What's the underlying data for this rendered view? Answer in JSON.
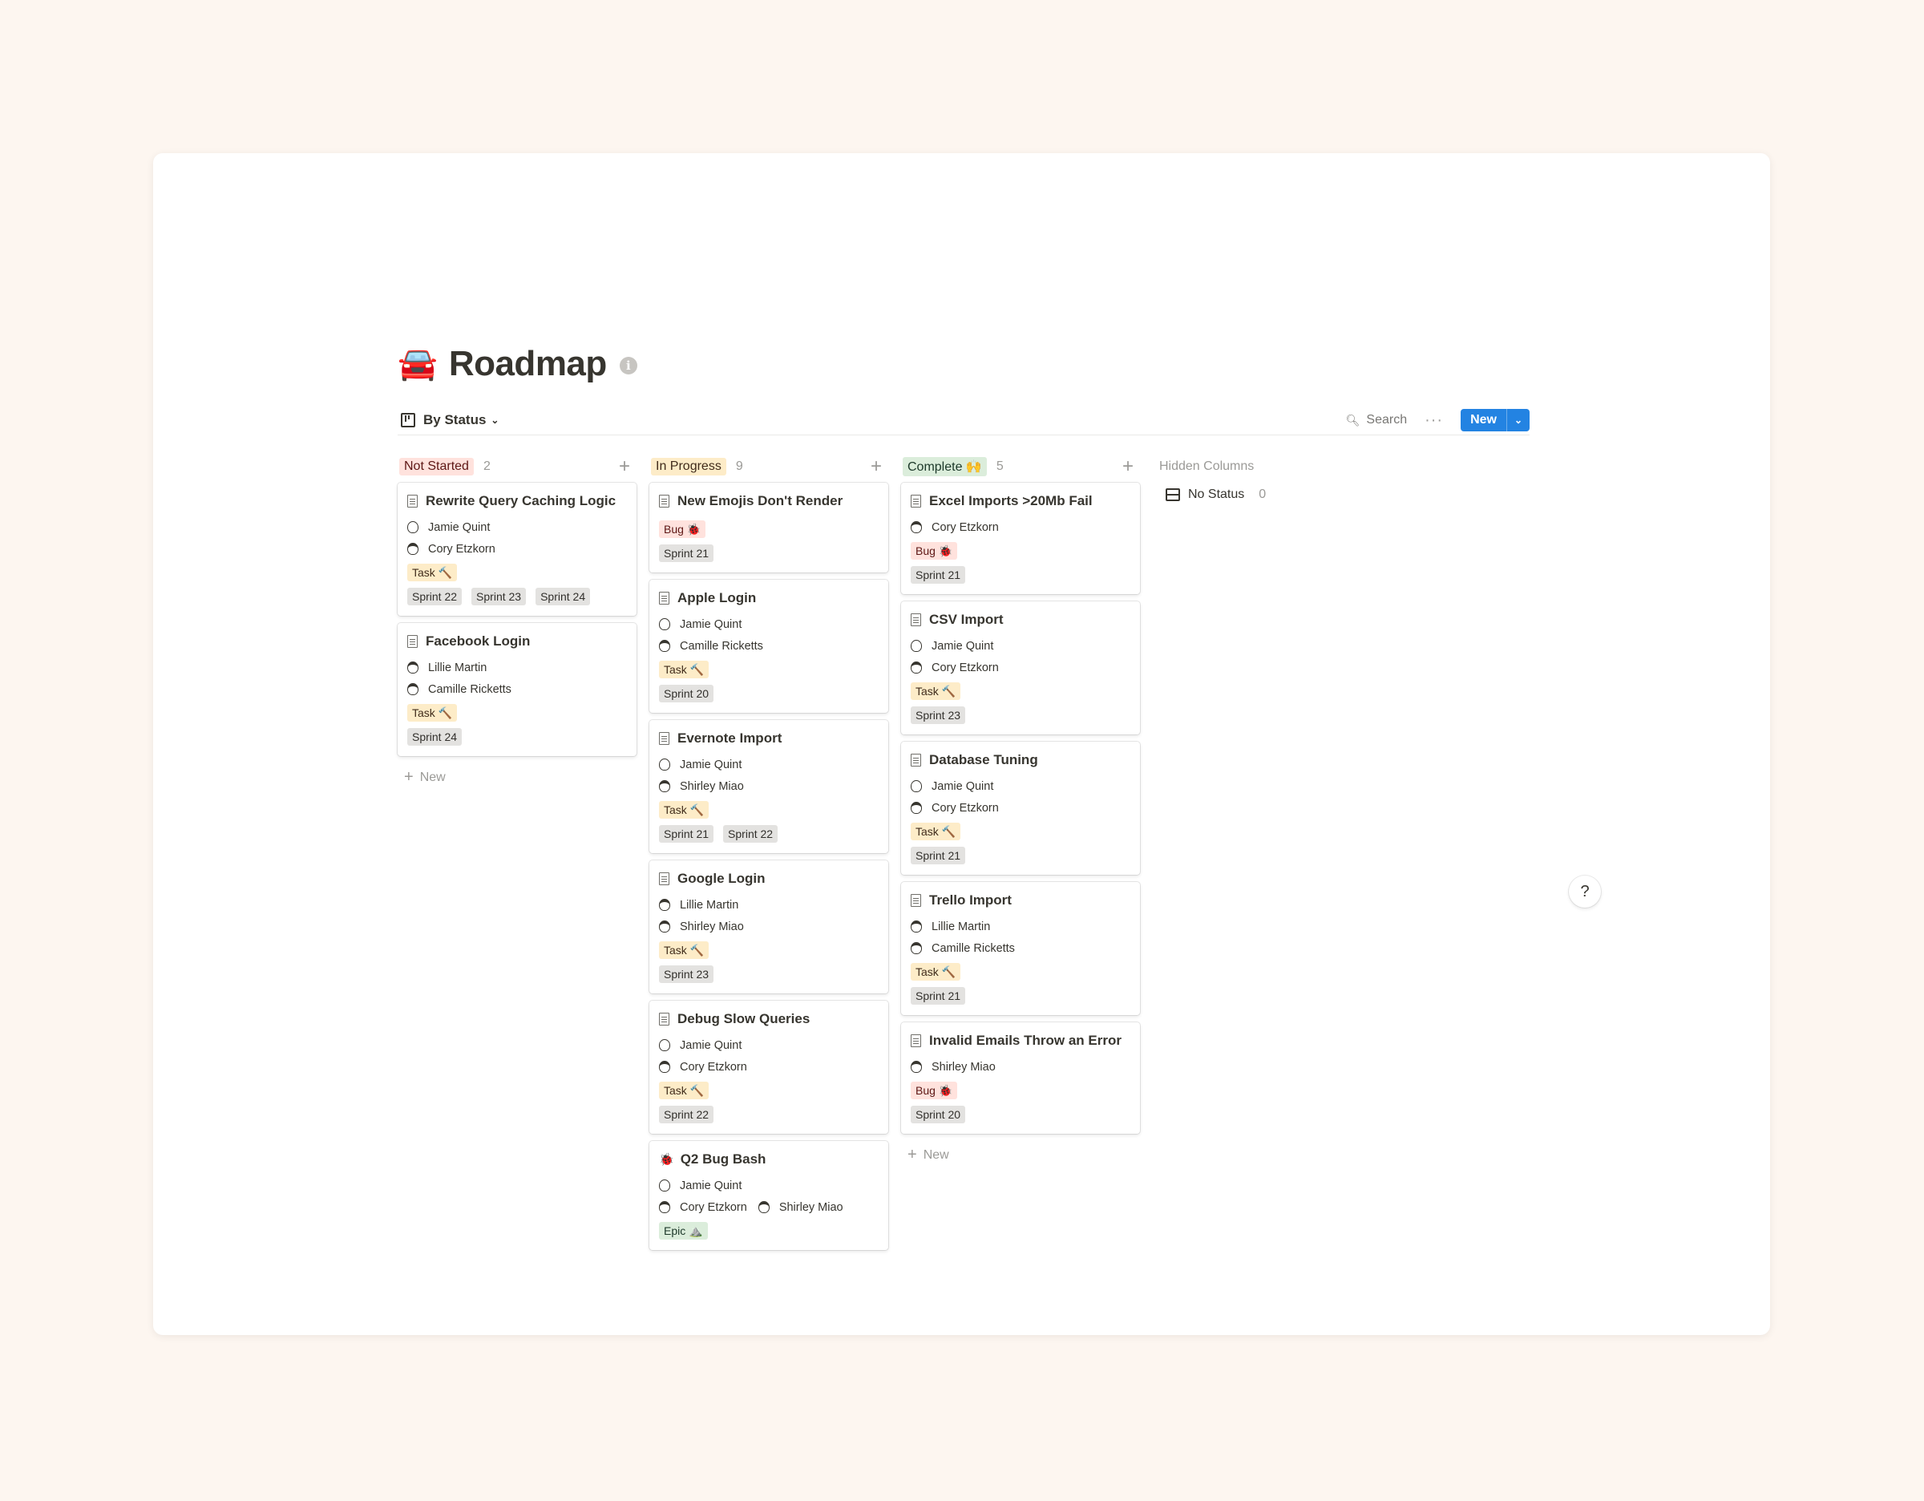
{
  "page": {
    "emoji": "🚘",
    "title": "Roadmap",
    "info_icon": "i"
  },
  "toolbar": {
    "view_label": "By Status",
    "search_label": "Search",
    "more_label": "···",
    "new_label": "New"
  },
  "columns": [
    {
      "status": "Not Started",
      "count": "2",
      "color": "#ffe2dd",
      "cards": [
        {
          "title": "Rewrite Query Caching Logic",
          "people": [
            [
              "Jamie Quint"
            ],
            [
              "Cory Etzkorn"
            ]
          ],
          "type": "Task 🔨",
          "type_class": "task",
          "sprints": [
            "Sprint 22",
            "Sprint 23",
            "Sprint 24"
          ]
        },
        {
          "title": "Facebook Login",
          "people": [
            [
              "Lillie Martin"
            ],
            [
              "Camille Ricketts"
            ]
          ],
          "type": "Task 🔨",
          "type_class": "task",
          "sprints": [
            "Sprint 24"
          ]
        }
      ],
      "new_label": "New"
    },
    {
      "status": "In Progress",
      "count": "9",
      "color": "#fdecc8",
      "cards": [
        {
          "title": "New Emojis Don't Render",
          "people": [],
          "type": "Bug 🐞",
          "type_class": "bug",
          "sprints": [
            "Sprint 21"
          ]
        },
        {
          "title": "Apple Login",
          "people": [
            [
              "Jamie Quint"
            ],
            [
              "Camille Ricketts"
            ]
          ],
          "type": "Task 🔨",
          "type_class": "task",
          "sprints": [
            "Sprint 20"
          ]
        },
        {
          "title": "Evernote Import",
          "people": [
            [
              "Jamie Quint"
            ],
            [
              "Shirley Miao"
            ]
          ],
          "type": "Task 🔨",
          "type_class": "task",
          "sprints": [
            "Sprint 21",
            "Sprint 22"
          ]
        },
        {
          "title": "Google Login",
          "people": [
            [
              "Lillie Martin"
            ],
            [
              "Shirley Miao"
            ]
          ],
          "type": "Task 🔨",
          "type_class": "task",
          "sprints": [
            "Sprint 23"
          ]
        },
        {
          "title": "Debug Slow Queries",
          "people": [
            [
              "Jamie Quint"
            ],
            [
              "Cory Etzkorn"
            ]
          ],
          "type": "Task 🔨",
          "type_class": "task",
          "sprints": [
            "Sprint 22"
          ]
        },
        {
          "title": "Q2 Bug Bash",
          "icon": "🐞",
          "people": [
            [
              "Jamie Quint"
            ],
            [
              "Cory Etzkorn",
              "Shirley Miao"
            ]
          ],
          "type": "Epic ⛰️",
          "type_class": "epic",
          "sprints": []
        }
      ]
    },
    {
      "status": "Complete 🙌",
      "count": "5",
      "color": "#dbeddb",
      "cards": [
        {
          "title": "Excel Imports >20Mb Fail",
          "people": [
            [
              "Cory Etzkorn"
            ]
          ],
          "type": "Bug 🐞",
          "type_class": "bug",
          "sprints": [
            "Sprint 21"
          ]
        },
        {
          "title": "CSV Import",
          "people": [
            [
              "Jamie Quint"
            ],
            [
              "Cory Etzkorn"
            ]
          ],
          "type": "Task 🔨",
          "type_class": "task",
          "sprints": [
            "Sprint 23"
          ]
        },
        {
          "title": "Database Tuning",
          "people": [
            [
              "Jamie Quint"
            ],
            [
              "Cory Etzkorn"
            ]
          ],
          "type": "Task 🔨",
          "type_class": "task",
          "sprints": [
            "Sprint 21"
          ]
        },
        {
          "title": "Trello Import",
          "people": [
            [
              "Lillie Martin"
            ],
            [
              "Camille Ricketts"
            ]
          ],
          "type": "Task 🔨",
          "type_class": "task",
          "sprints": [
            "Sprint 21"
          ]
        },
        {
          "title": "Invalid Emails Throw an Error",
          "people": [
            [
              "Shirley Miao"
            ]
          ],
          "type": "Bug 🐞",
          "type_class": "bug",
          "sprints": [
            "Sprint 20"
          ]
        }
      ],
      "new_label": "New"
    }
  ],
  "hidden": {
    "label": "Hidden Columns",
    "no_status_label": "No Status",
    "no_status_count": "0"
  },
  "help_label": "?"
}
